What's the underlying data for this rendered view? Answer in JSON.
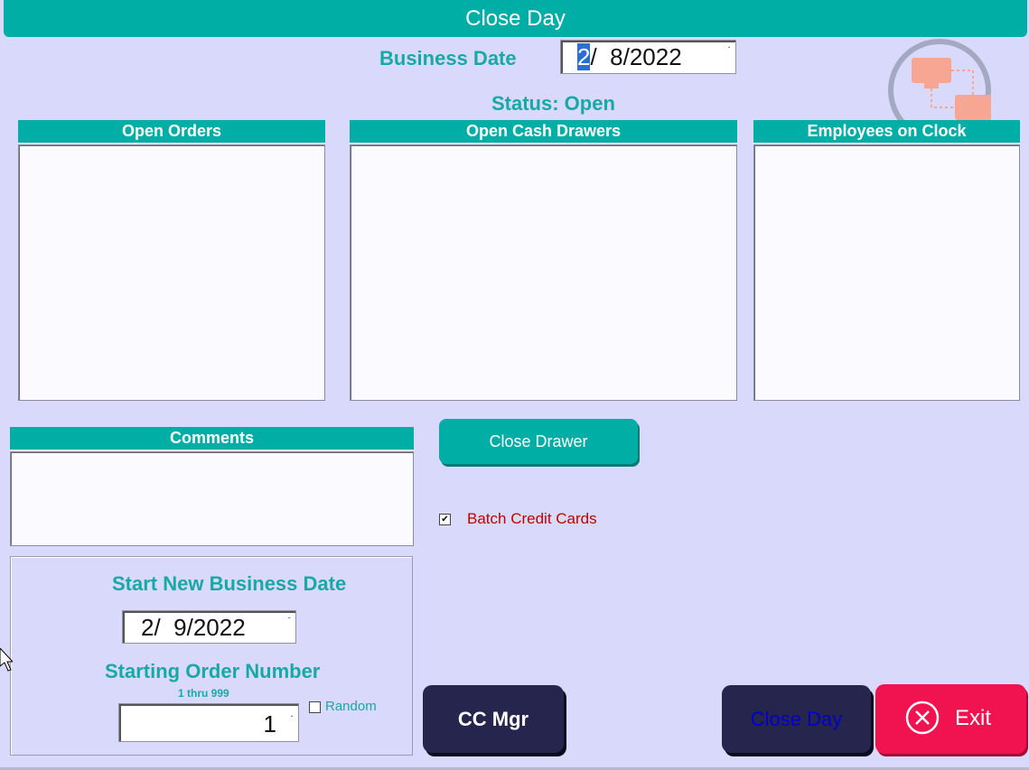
{
  "window": {
    "title": "Close Day"
  },
  "header": {
    "business_date_label": "Business Date",
    "business_date_sel": "2",
    "business_date_rest": "/  8/2022",
    "status": "Status: Open"
  },
  "panels": {
    "open_orders": "Open Orders",
    "open_cash_drawers": "Open Cash Drawers",
    "employees_on_clock": "Employees on Clock",
    "comments": "Comments"
  },
  "buttons": {
    "close_drawer": "Close Drawer",
    "cc_mgr": "CC Mgr",
    "close_day": "Close Day",
    "exit": "Exit"
  },
  "batch_credit_cards": {
    "label": "Batch Credit Cards",
    "checked": true
  },
  "new_business": {
    "title": "Start New Business Date",
    "date": "2/  9/2022",
    "order_label": "Starting Order Number",
    "range": "1 thru 999",
    "order_value": "1",
    "random_label": "Random"
  },
  "colors": {
    "accent": "#00aea6",
    "background": "#d9d9fb",
    "dark_button": "#25254d",
    "exit_button": "#f0134f",
    "batch_text": "#c00000"
  },
  "icons": [
    "remote-connection-icon",
    "close-circle-icon",
    "dropdown-arrow-icon",
    "mouse-cursor-icon"
  ]
}
